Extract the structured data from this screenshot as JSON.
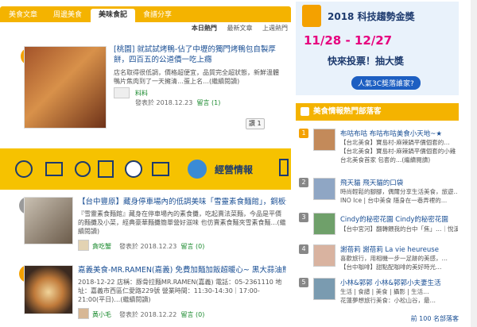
{
  "tabs": [
    "美食文章",
    "周邊美食",
    "美味食記",
    "食譜分享"
  ],
  "subnav": [
    "本日熱門",
    "最新文章",
    "上週熱門"
  ],
  "posts": [
    {
      "rank": "1",
      "title": "[桃園] 就試試烤鴨-佔了中壢的獨門烤鴨包自製厚餅，四百五的公道價一吃上癮",
      "desc": "店名取得很低調，價格超便宜，品質完全超狀態，新鮮溫體鴨片焦肉到了一天擁清…蛋上名…(繼續閱讀)",
      "author": "料料",
      "date": "發表於 2018.12.23",
      "comment": "留言 (1)",
      "like": "讚 1"
    },
    {
      "rank": "2",
      "title": "【台中豐原】藏身停車場內的低調美味「雪靈素食麵館」，銅板價素…",
      "desc": "『雪靈素食麵館』藏身在停車場內的素食攤，吃起賣法菜麵，今品是平價的麵攤及小菜，經典豪華麵攤簡單營好滋味 也仿賣素食麵夾雪素食麵…(繼續閱讀)",
      "author": "貪吃蟹",
      "date": "發表於 2018.12.23",
      "comment": "留言 (0)"
    },
    {
      "rank": "3",
      "title": "嘉義美食-MR.RAMEN(嘉義) 免費加麵加飯超暖心~ 黑大蒜油熊本拉…",
      "desc": "2018-12-22 店稱：豚骨拉麵MR.RAMEN(嘉義) 電話：05-2361110 地址：嘉義市西區仁愛路229號 營業時間：11:30-14:30｜17:00-21:00(平日)…(繼續閱讀)",
      "author": "黃小毛",
      "date": "發表於 2018.12.22",
      "comment": "留言 (0)"
    }
  ],
  "banner": {
    "title": "經營情報"
  },
  "ad": {
    "headline": "2018 科技趨勢金獎",
    "dates": "11/28 - 12/27",
    "vote": "快來投票！抽大獎",
    "sub": "人氣3C獎落誰家?"
  },
  "right_title": "美食情報熱門部落客",
  "bloggers": [
    {
      "num": "1",
      "name": "布咕布咕   布咕布咕美食小天地~★",
      "text": [
        "【台北美食】寶島村-麻辣鍋平價個套的…",
        "【台北美食】寶島村-麻辣鍋平價個套的小雞",
        "台北美食首家 包套的…(繼續閱讀)"
      ]
    },
    {
      "num": "2",
      "name": "飛天貓   飛天貓的口袋",
      "text": [
        "時尚輕鬆的腳腳，偶爾分享生活美食，旅遊…",
        "INO Ice | 台中美食 隱身在一巷弄裡的…"
      ]
    },
    {
      "num": "3",
      "name": "Cindy的秘密花園   Cindy的秘密花園",
      "text": [
        "【台中宮河】翻轉餵我的台中「焦」…｜悅溪美…"
      ]
    },
    {
      "num": "4",
      "name": "謝蓓莉   謝蓓莉 La vie heureuse",
      "text": [
        "喜歡旅行，用相機一步一足跡的美感，…",
        "【台中咖啡】甜點配咖啡的美好時光…"
      ]
    },
    {
      "num": "5",
      "name": "小林&郭郭   小林&郭郭小夫妻生活",
      "text": [
        "生活 | 食譜 | 美食 | 攝影 | 生活…",
        "花蓮夢想旅行美食：小松山谷，最…"
      ]
    }
  ],
  "more": "前 100 名部落客"
}
